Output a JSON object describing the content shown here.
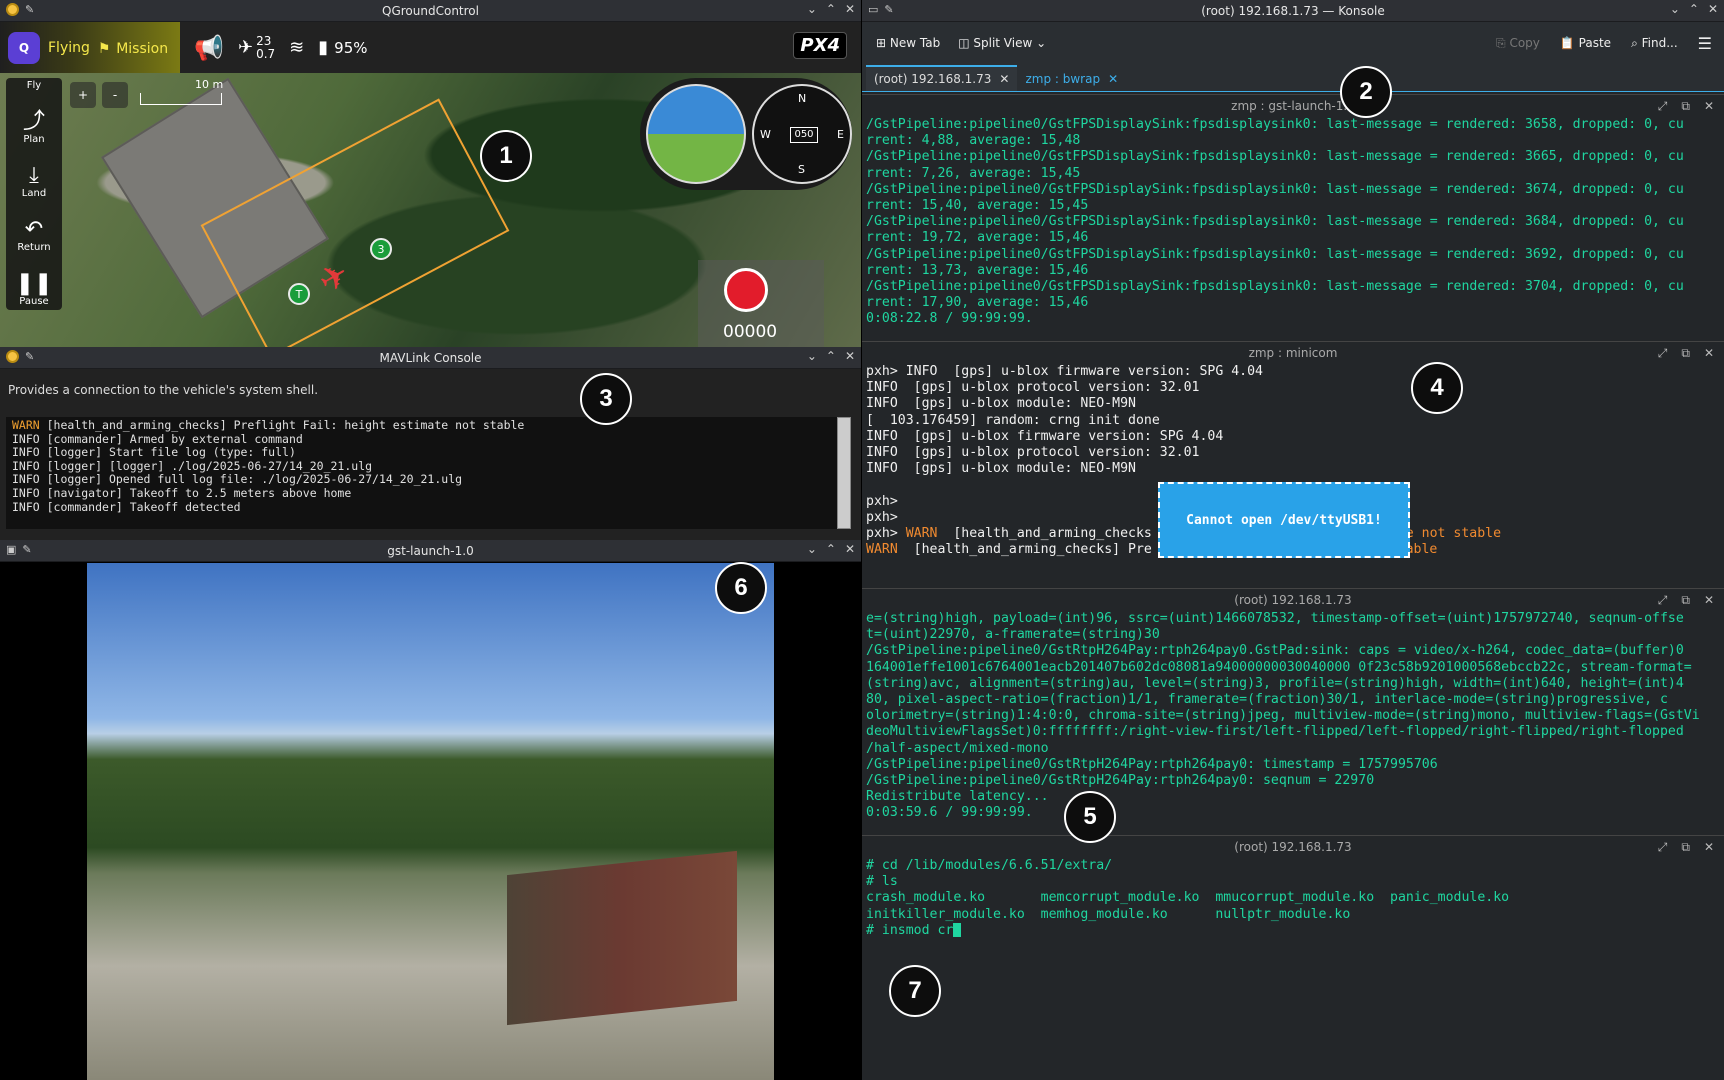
{
  "qgc": {
    "title": "QGroundControl",
    "status": "Flying",
    "mission": "Mission",
    "sats": "23",
    "hdop": "0.7",
    "battery": "95%",
    "logo": "PX4",
    "fly": "Fly",
    "plan": "Plan",
    "land": "Land",
    "return": "Return",
    "pause": "Pause",
    "scale": "10 m",
    "zoom_in": "+",
    "zoom_out": "-",
    "heading": "050",
    "compass": {
      "n": "N",
      "e": "E",
      "w": "W",
      "s": "S"
    },
    "rec_count": "00000",
    "wp_a": "3",
    "wp_b": "T"
  },
  "mav": {
    "title": "MAVLink Console",
    "desc": "Provides a connection to the vehicle's system shell.",
    "lines": [
      {
        "lvl": "WARN",
        "msg": " [health_and_arming_checks] Preflight Fail: height estimate not stable"
      },
      {
        "lvl": "INFO",
        "msg": " [commander] Armed by external command"
      },
      {
        "lvl": "INFO",
        "msg": " [logger] Start file log (type: full)"
      },
      {
        "lvl": "INFO",
        "msg": " [logger] [logger] ./log/2025-06-27/14_20_21.ulg"
      },
      {
        "lvl": "INFO",
        "msg": " [logger] Opened full log file: ./log/2025-06-27/14_20_21.ulg"
      },
      {
        "lvl": "INFO",
        "msg": " [navigator] Takeoff to 2.5 meters above home"
      },
      {
        "lvl": "INFO",
        "msg": " [commander] Takeoff detected"
      }
    ]
  },
  "gst": {
    "title": "gst-launch-1.0"
  },
  "konsole": {
    "title": "(root) 192.168.1.73 — Konsole",
    "new_tab": "New Tab",
    "split_view": "Split View",
    "copy": "Copy",
    "paste": "Paste",
    "find": "Find...",
    "tab1": "(root) 192.168.1.73",
    "tab2": "zmp : bwrap",
    "p1_title": "zmp : gst-launch-1.0",
    "p1": "/GstPipeline:pipeline0/GstFPSDisplaySink:fpsdisplaysink0: last-message = rendered: 3658, dropped: 0, cu\nrrent: 4,88, average: 15,48\n/GstPipeline:pipeline0/GstFPSDisplaySink:fpsdisplaysink0: last-message = rendered: 3665, dropped: 0, cu\nrrent: 7,26, average: 15,45\n/GstPipeline:pipeline0/GstFPSDisplaySink:fpsdisplaysink0: last-message = rendered: 3674, dropped: 0, cu\nrrent: 15,40, average: 15,45\n/GstPipeline:pipeline0/GstFPSDisplaySink:fpsdisplaysink0: last-message = rendered: 3684, dropped: 0, cu\nrrent: 19,72, average: 15,46\n/GstPipeline:pipeline0/GstFPSDisplaySink:fpsdisplaysink0: last-message = rendered: 3692, dropped: 0, cu\nrrent: 13,73, average: 15,46\n/GstPipeline:pipeline0/GstFPSDisplaySink:fpsdisplaysink0: last-message = rendered: 3704, dropped: 0, cu\nrrent: 17,90, average: 15,46\n0:08:22.8 / 99:99:99.",
    "p2_title": "zmp : minicom",
    "p2": "pxh> INFO  [gps] u-blox firmware version: SPG 4.04\nINFO  [gps] u-blox protocol version: 32.01\nINFO  [gps] u-blox module: NEO-M9N\n[  103.176459] random: crng init done\nINFO  [gps] u-blox firmware version: SPG 4.04\nINFO  [gps] u-blox protocol version: 32.01\nINFO  [gps] u-blox module: NEO-M9N\n\npxh>\npxh>",
    "p2_warn1_pre": "pxh> ",
    "p2_warn1_lvl": "WARN",
    "p2_warn1_msg": "  [health_and_arming_checks",
    "p2_warn1_tail": "te not stable",
    "p2_warn2_lvl": "WARN",
    "p2_warn2_msg": "  [health_and_arming_checks] Pre",
    "p2_warn2_tail": "t stable",
    "dialog": "Cannot open /dev/ttyUSB1!",
    "p3_title": "(root) 192.168.1.73",
    "p3": "e=(string)high, payload=(int)96, ssrc=(uint)1466078532, timestamp-offset=(uint)1757972740, seqnum-offse\nt=(uint)22970, a-framerate=(string)30\n/GstPipeline:pipeline0/GstRtpH264Pay:rtph264pay0.GstPad:sink: caps = video/x-h264, codec_data=(buffer)0\n164001effe1001c6764001eacb201407b602dc08081a94000000030040000 0f23c58b9201000568ebccb22c, stream-format=\n(string)avc, alignment=(string)au, level=(string)3, profile=(string)high, width=(int)640, height=(int)4\n80, pixel-aspect-ratio=(fraction)1/1, framerate=(fraction)30/1, interlace-mode=(string)progressive, c\nolorimetry=(string)1:4:0:0, chroma-site=(string)jpeg, multiview-mode=(string)mono, multiview-flags=(GstVi\ndeoMultiviewFlagsSet)0:ffffffff:/right-view-first/left-flipped/left-flopped/right-flipped/right-flopped\n/half-aspect/mixed-mono\n/GstPipeline:pipeline0/GstRtpH264Pay:rtph264pay0: timestamp = 1757995706\n/GstPipeline:pipeline0/GstRtpH264Pay:rtph264pay0: seqnum = 22970\nRedistribute latency...\n0:03:59.6 / 99:99:99.",
    "p4_title": "(root) 192.168.1.73",
    "p4": "# cd /lib/modules/6.6.51/extra/\n# ls\ncrash_module.ko       memcorrupt_module.ko  mmucorrupt_module.ko  panic_module.ko\ninitkiller_module.ko  memhog_module.ko      nullptr_module.ko\n# insmod cr"
  },
  "badges": [
    "1",
    "2",
    "3",
    "4",
    "5",
    "6",
    "7"
  ]
}
